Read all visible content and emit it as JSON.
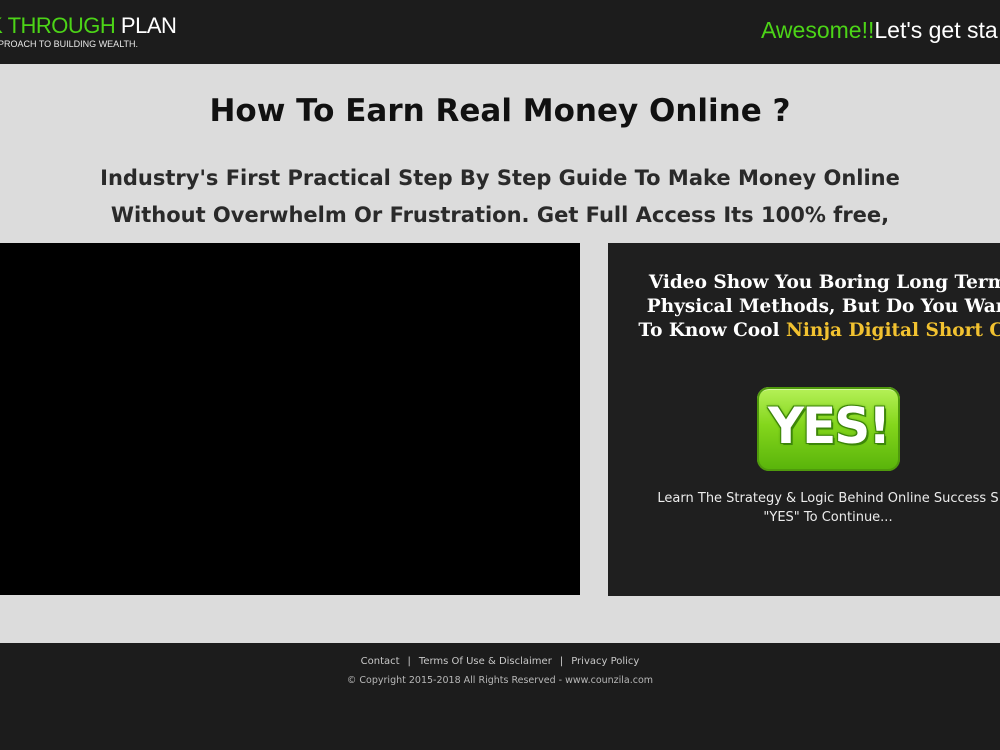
{
  "header": {
    "logo_green": "AK THROUGH",
    "logo_white": "PLAN",
    "logo_tagline": "PROACH TO BUILDING WEALTH.",
    "cta_green": "Awesome!!",
    "cta_white": "Let's get sta"
  },
  "main": {
    "headline": "How To Earn Real Money Online ?",
    "subheadline_line1": "Industry's First Practical Step By Step Guide To Make Money Online",
    "subheadline_line2": "Without Overwhelm Or Frustration. Get Full Access Its 100% free,"
  },
  "panel": {
    "title_line1": "Video Show You Boring Long Term",
    "title_line2": "Physical Methods, But Do You Wan",
    "title_line3_prefix": "To Know Cool ",
    "title_line3_highlight": "Ninja Digital Short Cu",
    "yes_button_label": "YES!",
    "desc_line1": "Learn The Strategy & Logic Behind Online Success S",
    "desc_line2": "\"YES\" To Continue..."
  },
  "footer": {
    "links": [
      "Contact",
      "Terms Of Use & Disclaimer",
      "Privacy Policy"
    ],
    "separator": "|",
    "copyright": "© Copyright 2015-2018 All Rights Reserved - www.counzila.com"
  },
  "colors": {
    "brand_green": "#4cd417",
    "highlight_gold": "#f2c230",
    "dark_bg": "#1c1c1c",
    "page_bg": "#dcdcdc"
  }
}
